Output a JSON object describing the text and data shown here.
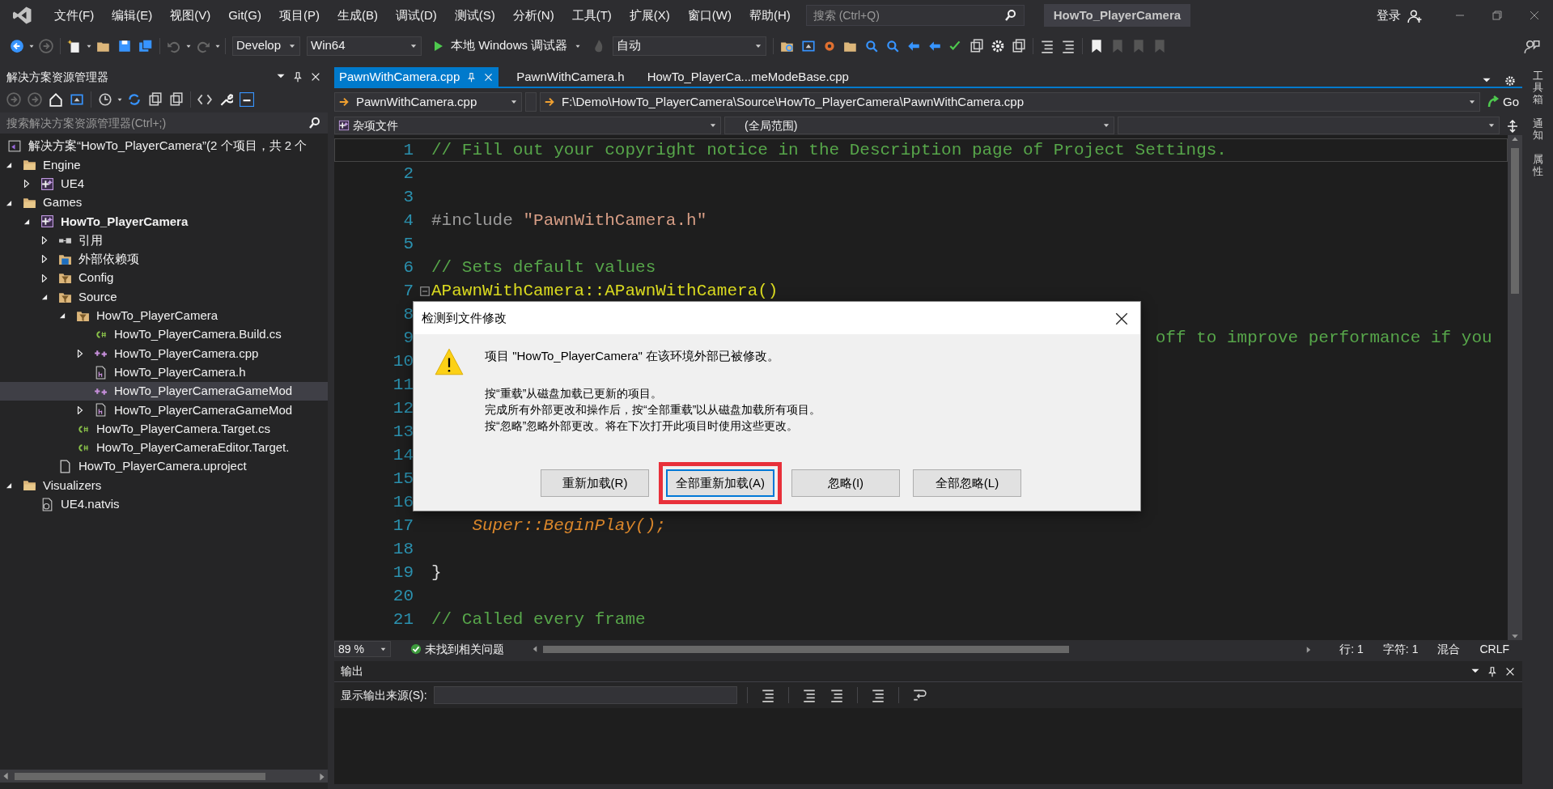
{
  "title_bar": {
    "menu": [
      "文件(F)",
      "编辑(E)",
      "视图(V)",
      "Git(G)",
      "项目(P)",
      "生成(B)",
      "调试(D)",
      "测试(S)",
      "分析(N)",
      "工具(T)",
      "扩展(X)",
      "窗口(W)",
      "帮助(H)"
    ],
    "search": {
      "placeholder": "搜索 (Ctrl+Q)"
    },
    "title": "HowTo_PlayerCamera",
    "sign_in": "登录"
  },
  "toolbar": {
    "configuration": "Develop",
    "platform": "Win64",
    "debugger": "本地 Windows 调试器",
    "target": "自动"
  },
  "solution_explorer": {
    "title": "解决方案资源管理器",
    "search": {
      "placeholder": "搜索解决方案资源管理器(Ctrl+;)"
    },
    "tree": [
      {
        "label": "解决方案“HowTo_PlayerCamera”(2 个项目，共 2 个",
        "kind": "solution",
        "selected": false,
        "children": [
          {
            "label": "Engine",
            "kind": "folder",
            "expanded": true,
            "selected": false,
            "children": [
              {
                "label": "UE4",
                "kind": "project",
                "expanded": false,
                "selected": false
              }
            ]
          },
          {
            "label": "Games",
            "kind": "folder",
            "expanded": true,
            "selected": false,
            "children": [
              {
                "label": "HowTo_PlayerCamera",
                "kind": "project",
                "expanded": true,
                "selected": false,
                "bold": true,
                "children": [
                  {
                    "label": "引用",
                    "kind": "references",
                    "expanded": false,
                    "selected": false
                  },
                  {
                    "label": "外部依赖项",
                    "kind": "dependencies",
                    "expanded": false,
                    "selected": false
                  },
                  {
                    "label": "Config",
                    "kind": "filter",
                    "expanded": false,
                    "selected": false
                  },
                  {
                    "label": "Source",
                    "kind": "filter",
                    "expanded": true,
                    "selected": false,
                    "children": [
                      {
                        "label": "HowTo_PlayerCamera",
                        "kind": "filter",
                        "expanded": true,
                        "selected": false,
                        "children": [
                          {
                            "label": "HowTo_PlayerCamera.Build.cs",
                            "kind": "csharp",
                            "selected": false
                          },
                          {
                            "label": "HowTo_PlayerCamera.cpp",
                            "kind": "cpp",
                            "expanded": false,
                            "selected": false
                          },
                          {
                            "label": "HowTo_PlayerCamera.h",
                            "kind": "header",
                            "selected": false
                          },
                          {
                            "label": "HowTo_PlayerCameraGameMod",
                            "kind": "cpp",
                            "selected": true
                          },
                          {
                            "label": "HowTo_PlayerCameraGameMod",
                            "kind": "header",
                            "expanded": false,
                            "selected": false
                          }
                        ]
                      },
                      {
                        "label": "HowTo_PlayerCamera.Target.cs",
                        "kind": "csharp",
                        "selected": false
                      },
                      {
                        "label": "HowTo_PlayerCameraEditor.Target.",
                        "kind": "csharp",
                        "selected": false
                      }
                    ]
                  },
                  {
                    "label": "HowTo_PlayerCamera.uproject",
                    "kind": "file",
                    "selected": false
                  }
                ]
              }
            ]
          },
          {
            "label": "Visualizers",
            "kind": "folder",
            "expanded": true,
            "selected": false,
            "children": [
              {
                "label": "UE4.natvis",
                "kind": "natvis",
                "selected": false
              }
            ]
          }
        ]
      }
    ]
  },
  "editor": {
    "tabs": [
      {
        "label": "PawnWithCamera.cpp",
        "selected": true
      },
      {
        "label": "PawnWithCamera.h",
        "selected": false
      },
      {
        "label": "HowTo_PlayerCa...meModeBase.cpp",
        "selected": false
      }
    ],
    "file_dropdown": "PawnWithCamera.cpp",
    "path": "F:\\Demo\\HowTo_PlayerCamera\\Source\\HowTo_PlayerCamera\\PawnWithCamera.cpp",
    "go": "Go",
    "project_dropdown": "杂项文件",
    "scope_dropdown": "(全局范围)",
    "code_lines": [
      {
        "number": "1",
        "segments": [
          {
            "text": "// Fill out your copyright notice in the Description page of Project Settings.",
            "kind": "comment"
          }
        ]
      },
      {
        "number": "2"
      },
      {
        "number": "3"
      },
      {
        "number": "4",
        "segments": [
          {
            "text": "#include ",
            "kind": "preprocessor"
          },
          {
            "text": "\"PawnWithCamera.h\"",
            "kind": "string"
          }
        ]
      },
      {
        "number": "5"
      },
      {
        "number": "6",
        "segments": [
          {
            "text": "// Sets default values",
            "kind": "comment"
          }
        ]
      },
      {
        "number": "7",
        "fold": true,
        "segments": [
          {
            "text": "APawnWithCamera::APawnWithCamera()",
            "kind": "function"
          }
        ]
      },
      {
        "number": "8"
      },
      {
        "number": "9",
        "covered_start": true,
        "segments": [
          {
            "text": "off to improve performance if you",
            "kind": "comment"
          }
        ]
      },
      {
        "number": "10"
      },
      {
        "number": "11"
      },
      {
        "number": "12"
      },
      {
        "number": "13"
      },
      {
        "number": "14"
      },
      {
        "number": "15"
      },
      {
        "number": "16"
      },
      {
        "number": "17",
        "kind": "indented",
        "segments": [
          {
            "text": "Super::BeginPlay();",
            "kind": "macro"
          }
        ]
      },
      {
        "number": "18"
      },
      {
        "number": "19",
        "segments": [
          {
            "text": "}",
            "kind": "plain"
          }
        ]
      },
      {
        "number": "20"
      },
      {
        "number": "21",
        "segments": [
          {
            "text": "// Called every frame",
            "kind": "comment"
          }
        ]
      }
    ],
    "status": {
      "zoom": "89 %",
      "issues": "未找到相关问题",
      "line": "行: 1",
      "char": "字符: 1",
      "mode": "混合",
      "eol": "CRLF"
    }
  },
  "output": {
    "title": "输出",
    "source_label": "显示输出来源(S):"
  },
  "side_tabs": [
    "工具箱",
    "通知",
    "属性"
  ],
  "dialog": {
    "title": "检测到文件修改",
    "message": "项目 \"HowTo_PlayerCamera\" 在该环境外部已被修改。",
    "details": [
      "按“重载”从磁盘加载已更新的项目。",
      "完成所有外部更改和操作后，按“全部重载”以从磁盘加载所有项目。",
      "按“忽略”忽略外部更改。将在下次打开此项目时使用这些更改。"
    ],
    "buttons": [
      {
        "label": "重新加载(R)",
        "default": false,
        "highlighted": false
      },
      {
        "label": "全部重新加载(A)",
        "default": true,
        "highlighted": true
      },
      {
        "label": "忽略(I)",
        "default": false,
        "highlighted": false
      },
      {
        "label": "全部忽略(L)",
        "default": false,
        "highlighted": false
      }
    ]
  }
}
